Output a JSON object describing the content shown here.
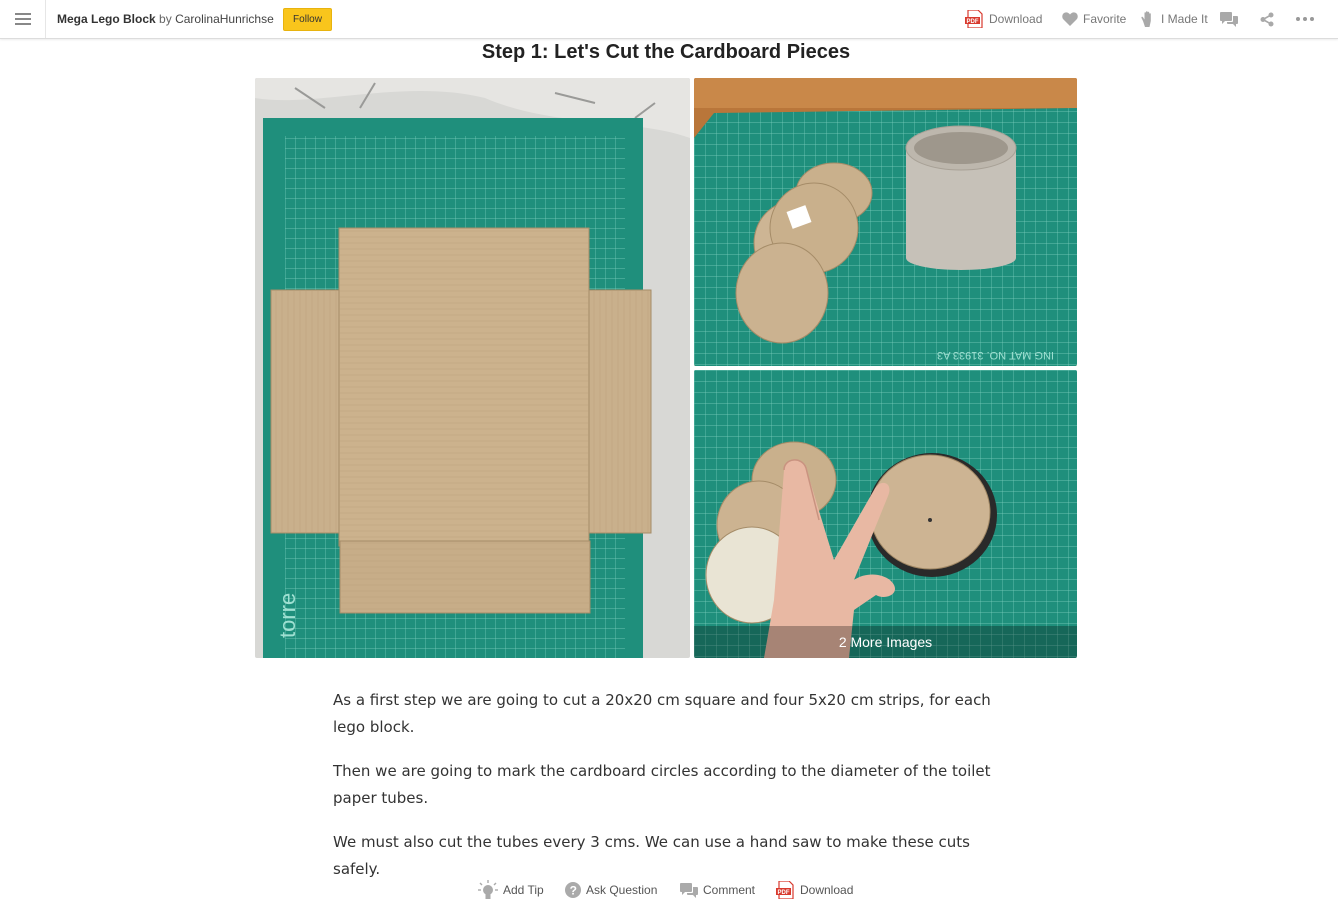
{
  "header": {
    "menu_icon": "hamburger-menu-icon",
    "project_title": "Mega Lego Block",
    "by_text": "by",
    "author": "CarolinaHunrichse",
    "follow_label": "Follow",
    "follow_color": "#f9c51c",
    "actions": [
      {
        "icon": "pdf-icon",
        "label": "Download"
      },
      {
        "icon": "heart-icon",
        "label": "Favorite"
      },
      {
        "icon": "hand-icon",
        "label": "I Made It"
      },
      {
        "icon": "comments-icon",
        "label": ""
      },
      {
        "icon": "share-icon",
        "label": ""
      },
      {
        "icon": "more-dots-icon",
        "label": ""
      }
    ]
  },
  "step": {
    "title": "Step 1: Let's Cut the Cardboard Pieces",
    "images": [
      {
        "subject": "cardboard square and four strips on green cutting mat"
      },
      {
        "subject": "cardboard circles and toilet paper tube on cutting mat"
      },
      {
        "subject": "hand holding cardboard circles next to tube"
      }
    ],
    "more_images_label": "2 More Images",
    "paragraphs": [
      "As a first step we are going to cut a 20x20 cm square and four 5x20 cm strips, for each lego block.",
      "Then we are going to mark the cardboard circles according to the diameter of the toilet paper tubes.",
      "We must also cut the tubes every 3 cms. We can use a hand saw to make these cuts safely."
    ]
  },
  "footer_actions": [
    {
      "icon": "lightbulb-icon",
      "label": "Add Tip"
    },
    {
      "icon": "question-icon",
      "label": "Ask Question"
    },
    {
      "icon": "comment-icon",
      "label": "Comment"
    },
    {
      "icon": "pdf-icon",
      "label": "Download"
    }
  ],
  "colors": {
    "mat_green": "#1f8f7c",
    "cardboard": "#c9b08c",
    "pdf_red": "#d83a2e"
  }
}
